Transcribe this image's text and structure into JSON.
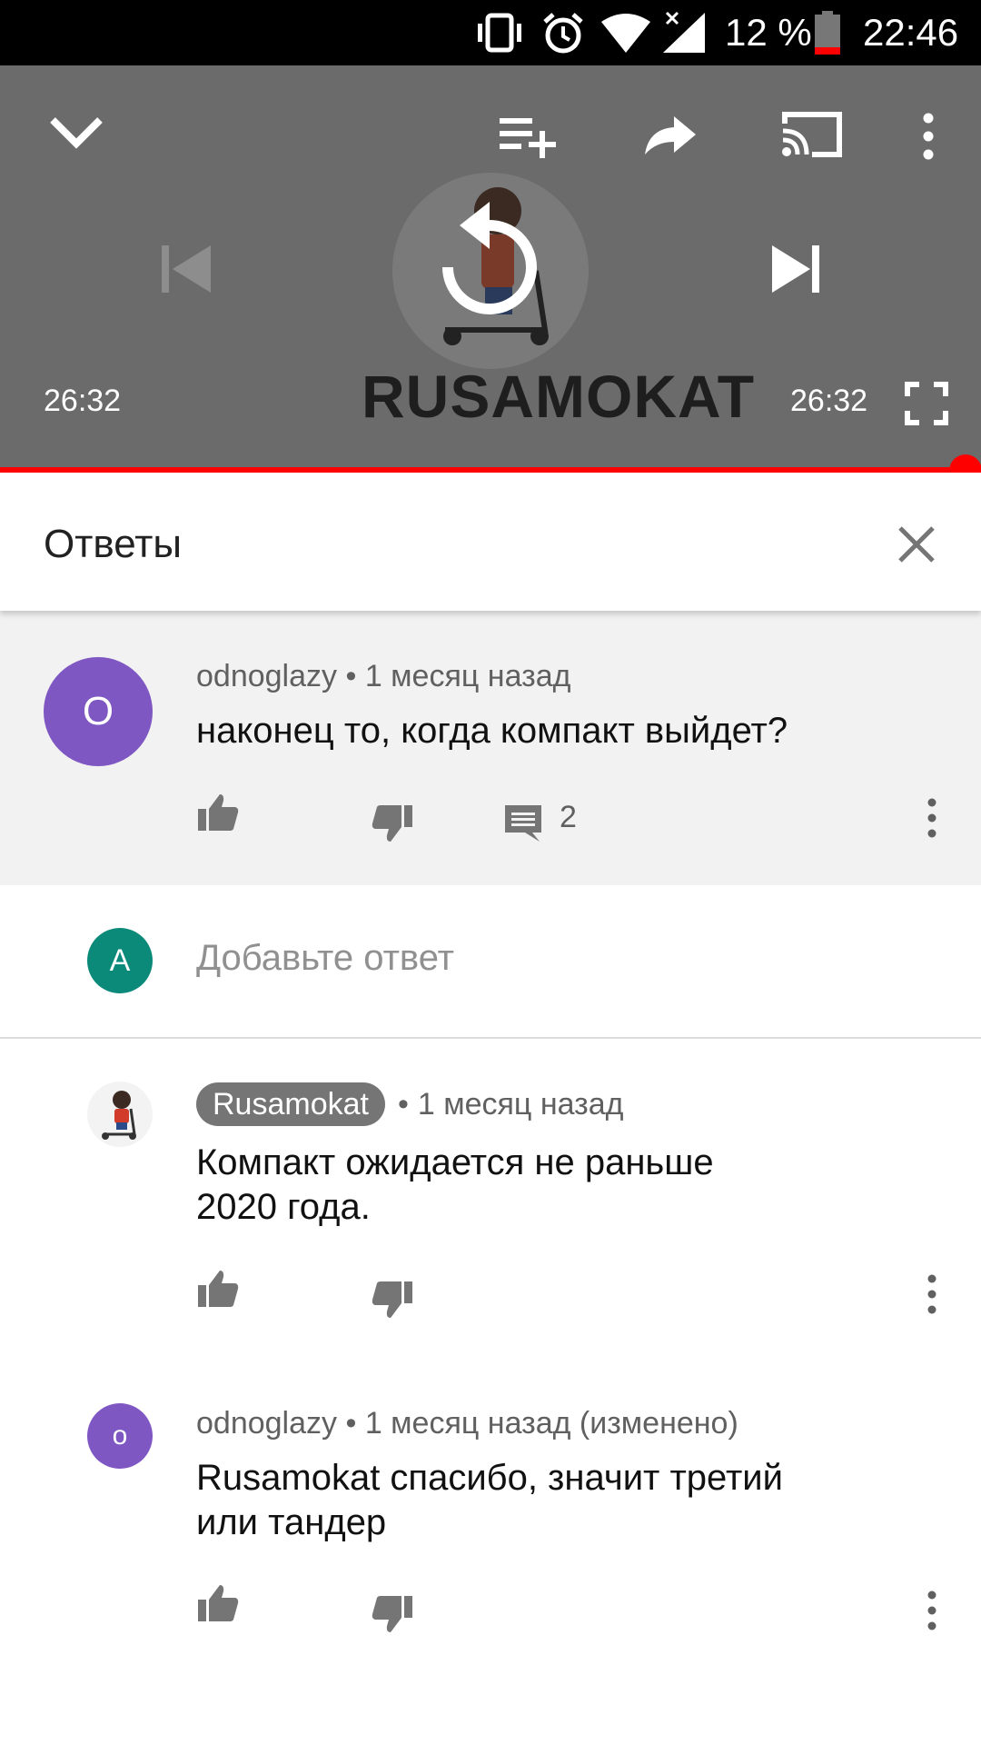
{
  "status_bar": {
    "battery_percent": "12 %",
    "time": "22:46",
    "icons": [
      "vibrate-icon",
      "alarm-icon",
      "wifi-icon",
      "signal-icon",
      "battery-icon"
    ]
  },
  "player": {
    "time_elapsed": "26:32",
    "time_total": "26:32",
    "progress": 1.0,
    "logo_text": "RUSAMOKAT",
    "accent_color": "#ff0000"
  },
  "replies_panel": {
    "title": "Ответы"
  },
  "parent_comment": {
    "avatar_letter": "O",
    "avatar_color": "#7e57c2",
    "author": "odnoglazy",
    "separator": "•",
    "time": "1 месяц назад",
    "text": "наконец то, когда компакт выйдет?",
    "reply_count": "2"
  },
  "reply_box": {
    "avatar_letter": "A",
    "avatar_color": "#0b8a7a",
    "placeholder": "Добавьте ответ"
  },
  "replies": [
    {
      "author": "Rusamokat",
      "separator": "•",
      "time": "1 месяц назад",
      "text_line1": "Компакт ожидается не раньше",
      "text_line2": "2020 года."
    },
    {
      "avatar_letter": "o",
      "avatar_color": "#7e57c2",
      "author": "odnoglazy",
      "separator": "•",
      "time": "1 месяц назад (изменено)",
      "text_line1": "Rusamokat спасибо, значит третий",
      "text_line2": "или тандер"
    }
  ]
}
